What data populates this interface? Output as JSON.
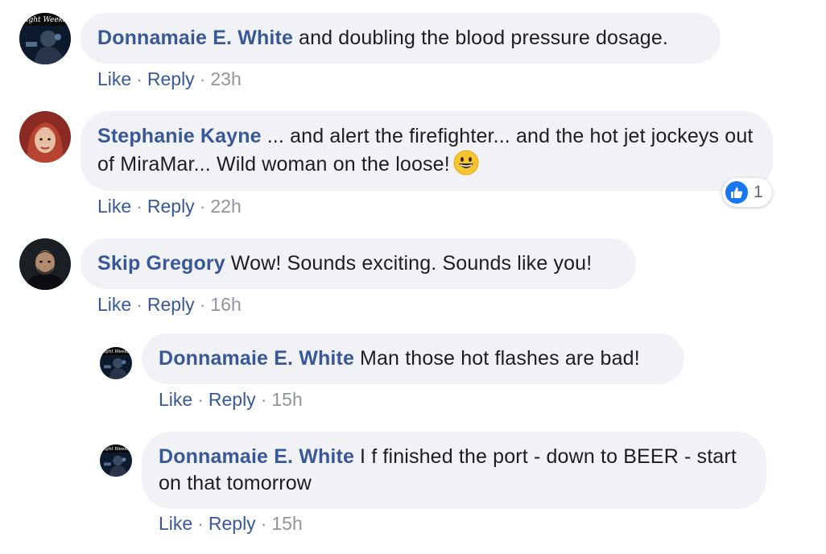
{
  "comments": [
    {
      "author": "Donnamaie E. White",
      "text": "and doubling the blood pressure dosage.",
      "like": "Like",
      "reply": "Reply",
      "sep": "·",
      "time": "23h",
      "avatar_badge": "Eight Weeks"
    },
    {
      "author": "Stephanie Kayne",
      "text": "... and alert the firefighter... and the hot jet jockeys out of MiraMar... Wild woman on the loose!",
      "emoji": "grinning-face-emoji",
      "like": "Like",
      "reply": "Reply",
      "sep": "·",
      "time": "22h",
      "reaction_count": "1",
      "reaction_icon": "thumbs-up-icon"
    },
    {
      "author": "Skip Gregory",
      "text": "Wow! Sounds exciting. Sounds like you!",
      "like": "Like",
      "reply": "Reply",
      "sep": "·",
      "time": "16h"
    },
    {
      "author": "Donnamaie E. White",
      "text": "Man those hot flashes are bad!",
      "like": "Like",
      "reply": "Reply",
      "sep": "·",
      "time": "15h",
      "avatar_badge": "Eight Weeks"
    },
    {
      "author": "Donnamaie E. White",
      "text": "I f finished the port - down to BEER - start on that tomorrow",
      "like": "Like",
      "reply": "Reply",
      "sep": "·",
      "time": "15h",
      "avatar_badge": "Eight Weeks"
    }
  ],
  "colors": {
    "bubble_bg": "#f0f2f5",
    "author_link": "#385898",
    "meta_gray": "#90949c",
    "like_blue": "#1877f2"
  }
}
